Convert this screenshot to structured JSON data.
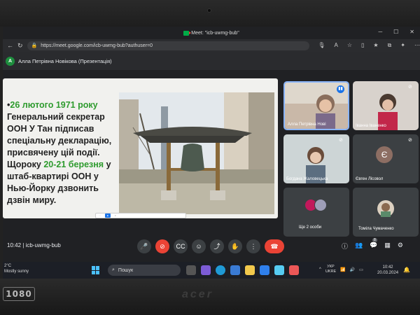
{
  "browser": {
    "tab_title": "Meet: \"icb-uwmg-bub\"",
    "url": "https://meet.google.com/icb-uwmg-bub?authuser=0"
  },
  "presenter": {
    "initial": "A",
    "label": "Алла Петрівна Новікова (Презентація)"
  },
  "slide": {
    "date_highlight": "26 лютого 1971 року",
    "text_part1": " Генеральний секретар ООН У Тан підписав спеціальну декларацію, присвячену цій події. Щороку ",
    "dates_highlight": "20-21 березня",
    "text_part2": " у штаб-квартирі ООН у Нью-Йорку дзвонить дзвін миру."
  },
  "participants": [
    {
      "name": "Алла Петрівна Нові",
      "speaking": true
    },
    {
      "name": "Іванна Іваненко",
      "speaking": false
    },
    {
      "name": "Богдана Жаловецька",
      "speaking": false
    },
    {
      "name": "Євген Лісовол",
      "initial": "Є",
      "speaking": false
    },
    {
      "name": "Ще 2 особи",
      "speaking": false
    },
    {
      "name": "Томіла Чумаченко",
      "speaking": false
    }
  ],
  "controls": {
    "time": "10:42",
    "room": "icb-uwmg-bub",
    "people_count": "8"
  },
  "taskbar": {
    "weather_temp": "2°C",
    "weather_desc": "Mostly sunny",
    "search_placeholder": "Пошук",
    "lang_line1": "УКР",
    "lang_line2": "UKRE",
    "clock_time": "10:42",
    "clock_date": "20.03.2024"
  },
  "laptop": {
    "badge": "1080",
    "brand": "acer"
  },
  "colors": {
    "accent_blue": "#1a73e8",
    "hangup_red": "#ea4335",
    "slide_green": "#2e9b2e"
  }
}
